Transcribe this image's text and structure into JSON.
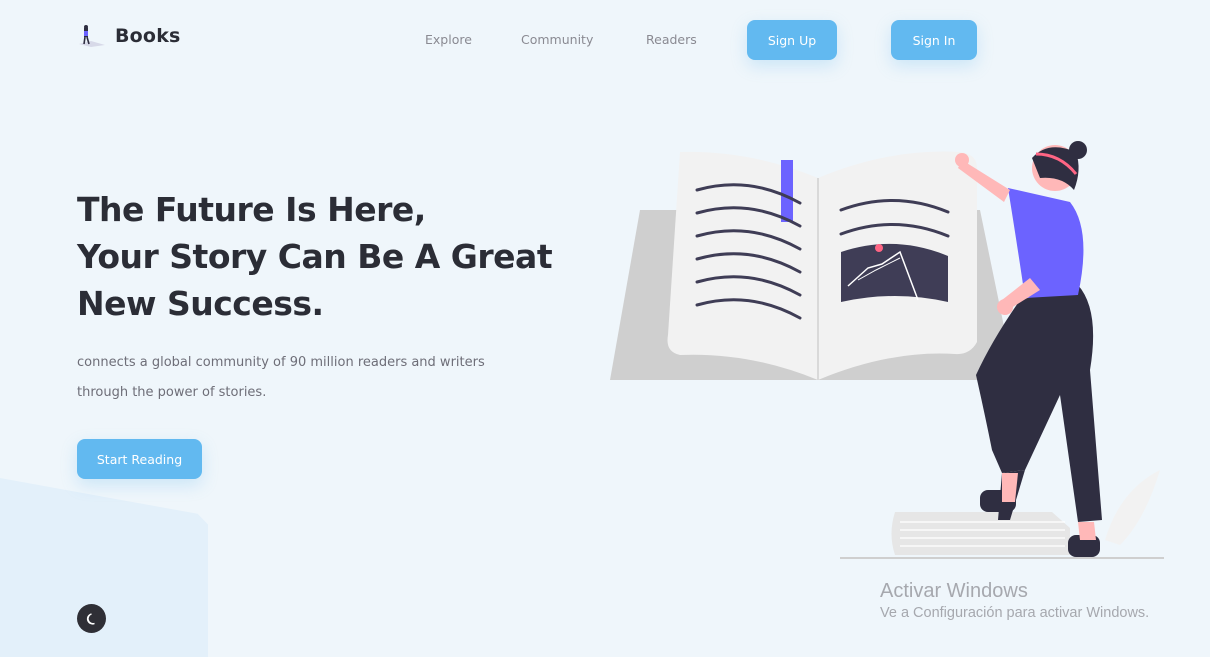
{
  "header": {
    "brand": "Books",
    "nav": [
      "Explore",
      "Community",
      "Readers"
    ],
    "signup_label": "Sign Up",
    "signin_label": "Sign In"
  },
  "hero": {
    "title_lines": [
      "The Future Is Here,",
      "Your Story Can Be A Great",
      "New Success."
    ],
    "subtitle_lines": [
      "connects a global community of 90 million readers and writers",
      "through the power of stories."
    ],
    "cta_label": "Start Reading"
  },
  "theme_toggle": {
    "icon": "moon-icon"
  },
  "watermark": {
    "title": "Activar Windows",
    "subtitle": "Ve a Configuración para activar Windows."
  },
  "colors": {
    "background": "#eff6fb",
    "accent": "#62b9f0",
    "heading": "#2b2d36",
    "illustration_purple": "#6c63ff",
    "illustration_skin": "#ffb8b8"
  }
}
